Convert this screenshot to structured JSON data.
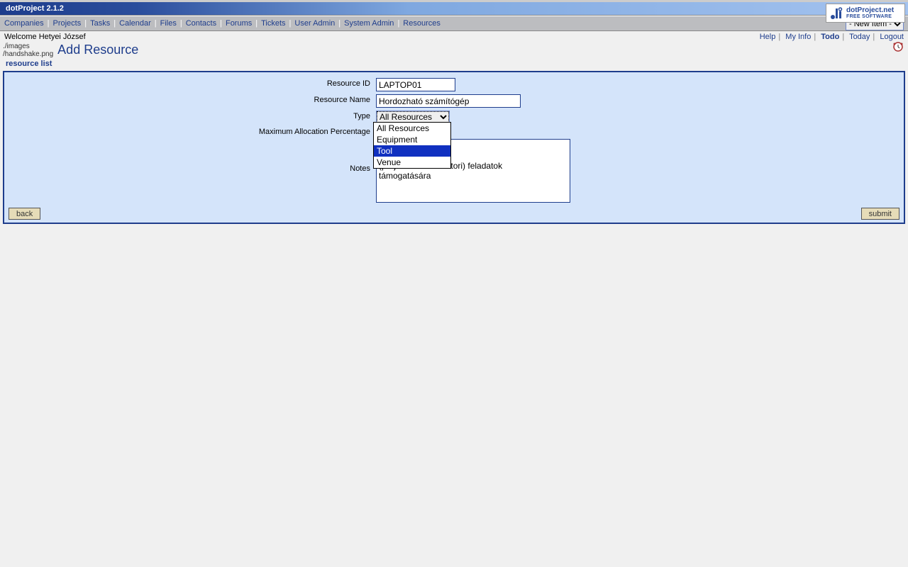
{
  "app_title": "dotProject 2.1.2",
  "brand": {
    "line1": "dotProject.net",
    "line2": "FREE SOFTWARE"
  },
  "menu": [
    "Companies",
    "Projects",
    "Tasks",
    "Calendar",
    "Files",
    "Contacts",
    "Forums",
    "Tickets",
    "User Admin",
    "System Admin",
    "Resources"
  ],
  "new_item_label": "- New Item -",
  "welcome": "Welcome Hetyei József",
  "toplinks": {
    "help": "Help",
    "myinfo": "My Info",
    "todo": "Todo",
    "today": "Today",
    "logout": "Logout"
  },
  "img_placeholder": "./images\n/handshake.png",
  "page_title": "Add Resource",
  "resource_list_link": "resource list",
  "form": {
    "resource_id_label": "Resource ID",
    "resource_id_value": "LAPTOP01",
    "resource_name_label": "Resource Name",
    "resource_name_value": "Hordozható számítógép",
    "type_label": "Type",
    "type_selected": "All Resources",
    "type_options": [
      "All Resources",
      "Equipment",
      "Tool",
      "Venue"
    ],
    "type_highlight": "Tool",
    "max_alloc_label": "Maximum Allocation Percentage",
    "notes_label": "Notes",
    "notes_value": "iítógép, dotProjekt\npjektvezetői\n(projektadminisztrátori) feladatok\ntámogatására"
  },
  "buttons": {
    "back": "back",
    "submit": "submit"
  }
}
